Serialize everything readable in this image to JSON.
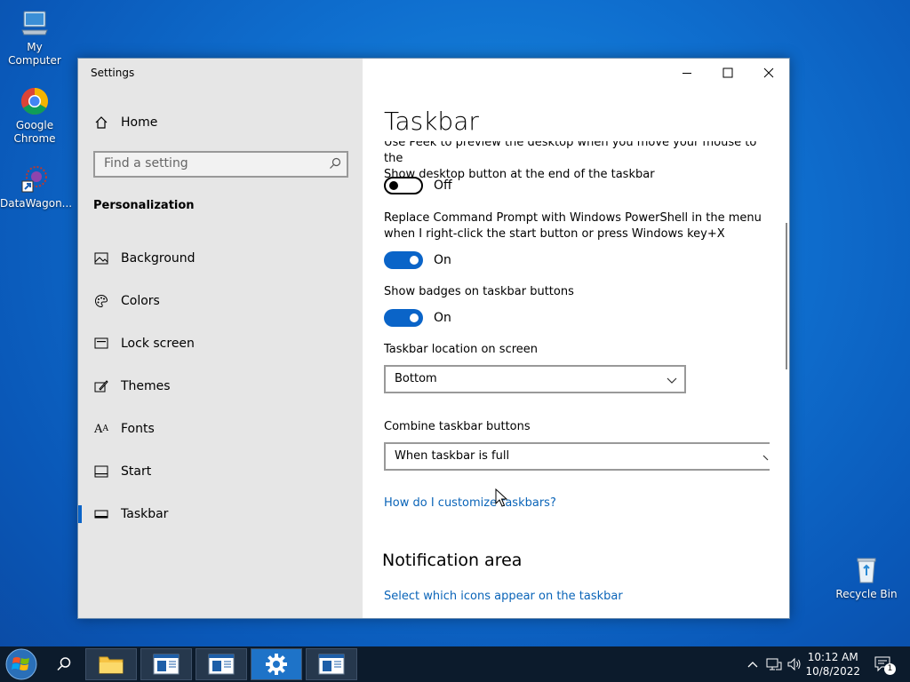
{
  "desktop": {
    "icons": [
      {
        "label": "My Computer"
      },
      {
        "label": "Google Chrome"
      },
      {
        "label": "DataWagon..."
      },
      {
        "label": "Recycle Bin"
      }
    ]
  },
  "window": {
    "title": "Settings",
    "controls": {
      "minimize": "—",
      "maximize": "☐",
      "close": "✕"
    }
  },
  "sidebar": {
    "home": "Home",
    "search_placeholder": "Find a setting",
    "section": "Personalization",
    "items": [
      {
        "label": "Background",
        "icon": "image-icon"
      },
      {
        "label": "Colors",
        "icon": "palette-icon"
      },
      {
        "label": "Lock screen",
        "icon": "lock-screen-icon"
      },
      {
        "label": "Themes",
        "icon": "brush-icon"
      },
      {
        "label": "Fonts",
        "icon": "fonts-icon"
      },
      {
        "label": "Start",
        "icon": "start-icon"
      },
      {
        "label": "Taskbar",
        "icon": "taskbar-icon",
        "selected": true
      }
    ]
  },
  "main": {
    "title": "Taskbar",
    "peek_text_line1": "Use Peek to preview the desktop when you move your mouse to the",
    "peek_text_line2": "Show desktop button at the end of the taskbar",
    "peek_toggle": "Off",
    "powershell_text": "Replace Command Prompt with Windows PowerShell in the menu when I right-click the start button or press Windows key+X",
    "powershell_toggle": "On",
    "badges_text": "Show badges on taskbar buttons",
    "badges_toggle": "On",
    "location_label": "Taskbar location on screen",
    "location_value": "Bottom",
    "combine_label": "Combine taskbar buttons",
    "combine_value": "When taskbar is full",
    "help_link": "How do I customize taskbars?",
    "notification_heading": "Notification area",
    "notification_link": "Select which icons appear on the taskbar"
  },
  "taskbar": {
    "time": "10:12 AM",
    "date": "10/8/2022",
    "notification_count": "1"
  },
  "colors": {
    "accent": "#0a64c8",
    "taskbar": "#0c1b2c"
  }
}
